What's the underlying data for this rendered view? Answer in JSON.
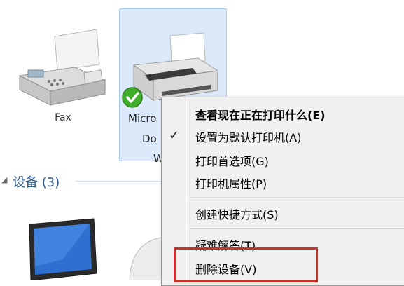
{
  "devices": {
    "fax": {
      "label": "Fax"
    },
    "printer": {
      "label_lines": [
        "Micro",
        "Do",
        "W"
      ]
    }
  },
  "sections": {
    "devices_header": {
      "title": "设备 (3)"
    }
  },
  "context_menu": {
    "items": [
      {
        "label": "查看现在正在打印什么(E)",
        "bold": true
      },
      {
        "label": "设置为默认打印机(A)",
        "checked": true
      },
      {
        "label": "打印首选项(G)"
      },
      {
        "label": "打印机属性(P)"
      },
      {
        "label": "创建快捷方式(S)"
      },
      {
        "label": "疑难解答(T)"
      },
      {
        "label": "删除设备(V)"
      }
    ]
  },
  "colors": {
    "selection_bg": "#dbe9fb",
    "highlight_border": "#c8302a",
    "section_title": "#2e5a8b"
  }
}
